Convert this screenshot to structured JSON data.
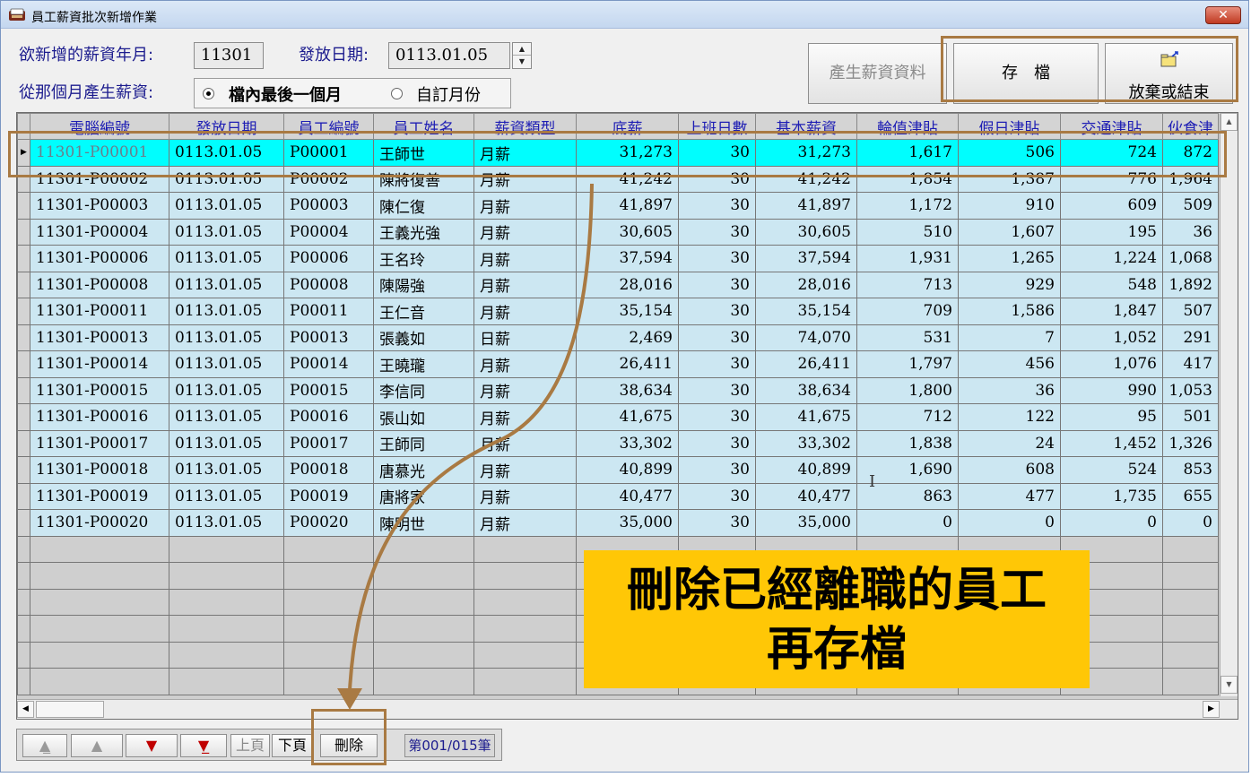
{
  "window": {
    "title": "員工薪資批次新增作業",
    "close_label": "✕"
  },
  "form": {
    "year_month_label": "欲新增的薪資年月:",
    "year_month_value": "11301",
    "date_label": "發放日期:",
    "date_value": "0113.01.05",
    "source_label": "從那個月產生薪資:",
    "radio_last_month": "檔內最後一個月",
    "radio_custom": "自訂月份",
    "radio_selected": "last_month"
  },
  "toolbar": {
    "generate_label": "產生薪資資料",
    "save_label": "存　檔",
    "exit_label": "放棄或結束"
  },
  "grid": {
    "columns": [
      "電腦編號",
      "發放日期",
      "員工編號",
      "員工姓名",
      "薪資類型",
      "底薪",
      "上班日數",
      "基本薪資",
      "輪值津貼",
      "假日津貼",
      "交通津貼",
      "伙食津"
    ],
    "rows": [
      [
        "11301-P00001",
        "0113.01.05",
        "P00001",
        "王師世",
        "月薪",
        "31,273",
        "30",
        "31,273",
        "1,617",
        "506",
        "724",
        "872"
      ],
      [
        "11301-P00002",
        "0113.01.05",
        "P00002",
        "陳將復善",
        "月薪",
        "41,242",
        "30",
        "41,242",
        "1,854",
        "1,387",
        "776",
        "1,964"
      ],
      [
        "11301-P00003",
        "0113.01.05",
        "P00003",
        "陳仁復",
        "月薪",
        "41,897",
        "30",
        "41,897",
        "1,172",
        "910",
        "609",
        "509"
      ],
      [
        "11301-P00004",
        "0113.01.05",
        "P00004",
        "王義光強",
        "月薪",
        "30,605",
        "30",
        "30,605",
        "510",
        "1,607",
        "195",
        "36"
      ],
      [
        "11301-P00006",
        "0113.01.05",
        "P00006",
        "王名玲",
        "月薪",
        "37,594",
        "30",
        "37,594",
        "1,931",
        "1,265",
        "1,224",
        "1,068"
      ],
      [
        "11301-P00008",
        "0113.01.05",
        "P00008",
        "陳陽強",
        "月薪",
        "28,016",
        "30",
        "28,016",
        "713",
        "929",
        "548",
        "1,892"
      ],
      [
        "11301-P00011",
        "0113.01.05",
        "P00011",
        "王仁音",
        "月薪",
        "35,154",
        "30",
        "35,154",
        "709",
        "1,586",
        "1,847",
        "507"
      ],
      [
        "11301-P00013",
        "0113.01.05",
        "P00013",
        "張義如",
        "日薪",
        "2,469",
        "30",
        "74,070",
        "531",
        "7",
        "1,052",
        "291"
      ],
      [
        "11301-P00014",
        "0113.01.05",
        "P00014",
        "王曉瓏",
        "月薪",
        "26,411",
        "30",
        "26,411",
        "1,797",
        "456",
        "1,076",
        "417"
      ],
      [
        "11301-P00015",
        "0113.01.05",
        "P00015",
        "李信同",
        "月薪",
        "38,634",
        "30",
        "38,634",
        "1,800",
        "36",
        "990",
        "1,053"
      ],
      [
        "11301-P00016",
        "0113.01.05",
        "P00016",
        "張山如",
        "月薪",
        "41,675",
        "30",
        "41,675",
        "712",
        "122",
        "95",
        "501"
      ],
      [
        "11301-P00017",
        "0113.01.05",
        "P00017",
        "王師同",
        "月薪",
        "33,302",
        "30",
        "33,302",
        "1,838",
        "24",
        "1,452",
        "1,326"
      ],
      [
        "11301-P00018",
        "0113.01.05",
        "P00018",
        "唐慕光",
        "月薪",
        "40,899",
        "30",
        "40,899",
        "1,690",
        "608",
        "524",
        "853"
      ],
      [
        "11301-P00019",
        "0113.01.05",
        "P00019",
        "唐將家",
        "月薪",
        "40,477",
        "30",
        "40,477",
        "863",
        "477",
        "1,735",
        "655"
      ],
      [
        "11301-P00020",
        "0113.01.05",
        "P00020",
        "陳明世",
        "月薪",
        "35,000",
        "30",
        "35,000",
        "0",
        "0",
        "0",
        "0"
      ]
    ],
    "selected_row": 0,
    "blank_rows": 6
  },
  "navigation": {
    "prev_page_label": "上頁",
    "next_page_label": "下頁",
    "delete_label": "刪除",
    "record_label": "第001/015筆"
  },
  "annotation": {
    "line1": "刪除已經離職的員工",
    "line2": "再存檔",
    "highlight_color": "#a97a43",
    "callout_color": "#ffc706"
  },
  "colors": {
    "row_normal": "#cce7f2",
    "row_selected": "#00fefe",
    "header_text": "#1e1eb4",
    "label_text": "#1c1c8e"
  }
}
